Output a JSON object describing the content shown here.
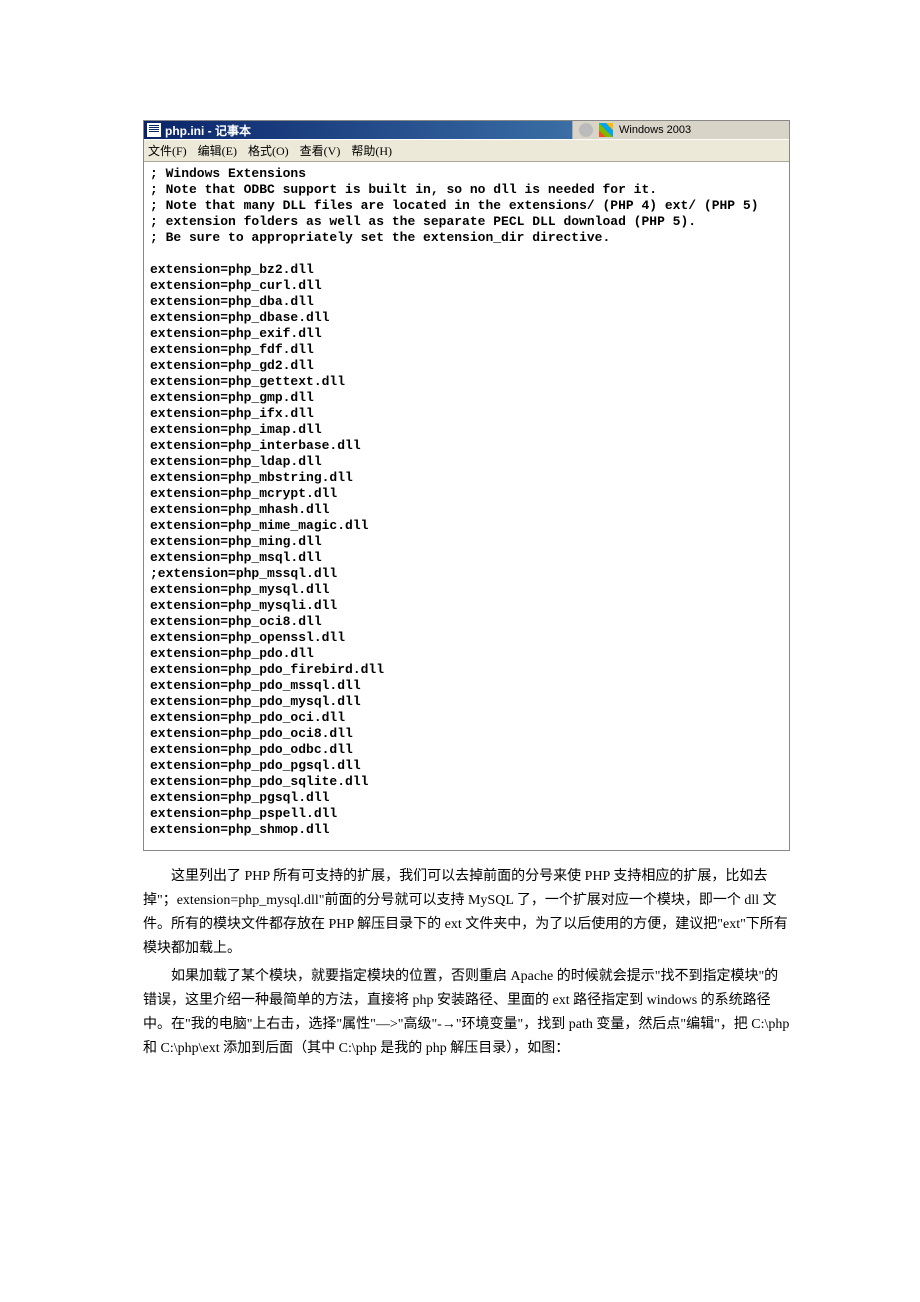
{
  "window": {
    "title": "php.ini - 记事本",
    "inactive_label": "Windows 2003",
    "menu": {
      "file": "文件(F)",
      "edit": "编辑(E)",
      "format": "格式(O)",
      "view": "查看(V)",
      "help": "帮助(H)"
    }
  },
  "editor": {
    "content": "; Windows Extensions\n; Note that ODBC support is built in, so no dll is needed for it.\n; Note that many DLL files are located in the extensions/ (PHP 4) ext/ (PHP 5)\n; extension folders as well as the separate PECL DLL download (PHP 5).\n; Be sure to appropriately set the extension_dir directive.\n\nextension=php_bz2.dll\nextension=php_curl.dll\nextension=php_dba.dll\nextension=php_dbase.dll\nextension=php_exif.dll\nextension=php_fdf.dll\nextension=php_gd2.dll\nextension=php_gettext.dll\nextension=php_gmp.dll\nextension=php_ifx.dll\nextension=php_imap.dll\nextension=php_interbase.dll\nextension=php_ldap.dll\nextension=php_mbstring.dll\nextension=php_mcrypt.dll\nextension=php_mhash.dll\nextension=php_mime_magic.dll\nextension=php_ming.dll\nextension=php_msql.dll\n;extension=php_mssql.dll\nextension=php_mysql.dll\nextension=php_mysqli.dll\nextension=php_oci8.dll\nextension=php_openssl.dll\nextension=php_pdo.dll\nextension=php_pdo_firebird.dll\nextension=php_pdo_mssql.dll\nextension=php_pdo_mysql.dll\nextension=php_pdo_oci.dll\nextension=php_pdo_oci8.dll\nextension=php_pdo_odbc.dll\nextension=php_pdo_pgsql.dll\nextension=php_pdo_sqlite.dll\nextension=php_pgsql.dll\nextension=php_pspell.dll\nextension=php_shmop.dll"
  },
  "body": {
    "p1": "这里列出了 PHP 所有可支持的扩展，我们可以去掉前面的分号来使 PHP 支持相应的扩展，比如去掉\"；extension=php_mysql.dll\"前面的分号就可以支持 MySQL 了，一个扩展对应一个模块，即一个 dll 文件。所有的模块文件都存放在 PHP 解压目录下的 ext 文件夹中，为了以后使用的方便，建议把\"ext\"下所有模块都加载上。",
    "p2": "如果加载了某个模块，就要指定模块的位置，否则重启 Apache 的时候就会提示\"找不到指定模块\"的错误，这里介绍一种最简单的方法，直接将 php 安装路径、里面的 ext 路径指定到 windows 的系统路径中。在\"我的电脑\"上右击，选择\"属性\"—>\"高级\"-→\"环境变量\"，找到 path 变量，然后点\"编辑\"，把 C:\\php 和 C:\\php\\ext 添加到后面（其中 C:\\php 是我的 php 解压目录），如图："
  }
}
